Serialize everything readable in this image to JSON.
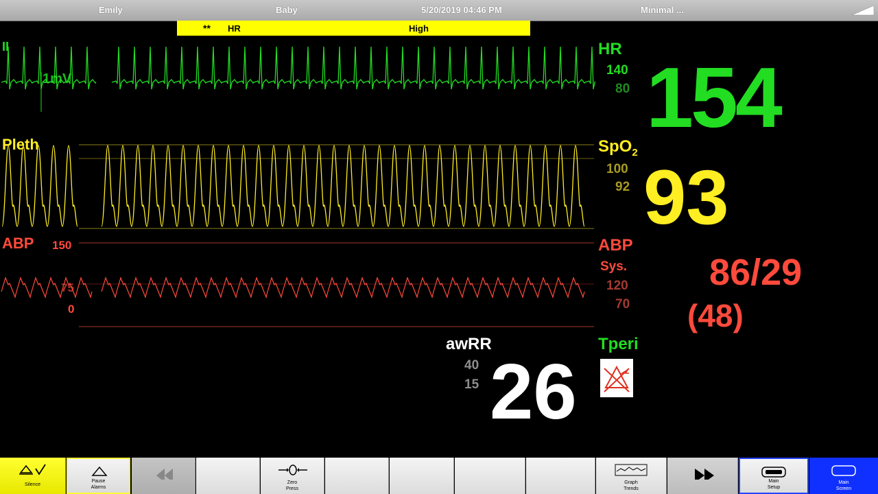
{
  "header": {
    "patient_name": "Emily",
    "patient_type": "Baby",
    "datetime": "5/20/2019 04:46 PM",
    "profile": "Minimal ..."
  },
  "alarm": {
    "severity": "**",
    "parameter": "HR",
    "condition": "High",
    "color": "#ffff00"
  },
  "waves": {
    "ecg": {
      "lead": "II",
      "scale": "1mV",
      "color": "#22dd22"
    },
    "pleth": {
      "label": "Pleth",
      "color": "#ffee22"
    },
    "abp": {
      "label": "ABP",
      "scale_top": "150",
      "scale_mid": "75",
      "scale_bottom": "0",
      "color": "#ff4a3c"
    }
  },
  "params": {
    "hr": {
      "label": "HR",
      "alarm_high": "140",
      "alarm_low": "80",
      "value": "154"
    },
    "spo2": {
      "label": "SpO",
      "label_sub": "2",
      "alarm_high": "100",
      "alarm_low": "92",
      "value": "93"
    },
    "abp": {
      "label": "ABP",
      "sub_label": "Sys.",
      "alarm_high": "120",
      "alarm_low": "70",
      "value": "86/29",
      "mean": "(48)"
    },
    "awrr": {
      "label": "awRR",
      "alarm_high": "40",
      "alarm_low": "15",
      "value": "26"
    },
    "tperi": {
      "label": "Tperi",
      "icon": "alarm-off-icon"
    }
  },
  "footer": {
    "silence": "Silence",
    "pause_alarms_1": "Pause",
    "pause_alarms_2": "Alarms",
    "zero_press_1": "Zero",
    "zero_press_2": "Press",
    "graph_trends_1": "Graph",
    "graph_trends_2": "Trends",
    "main_setup_1": "Main",
    "main_setup_2": "Setup",
    "main_screen_1": "Main",
    "main_screen_2": "Screen"
  }
}
